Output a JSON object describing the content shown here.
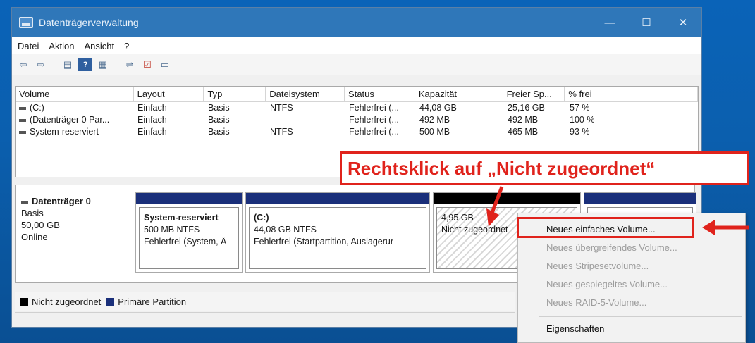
{
  "window": {
    "title": "Datenträgerverwaltung",
    "controls": [
      "—",
      "☐",
      "✕"
    ]
  },
  "menubar": [
    "Datei",
    "Aktion",
    "Ansicht",
    "?"
  ],
  "toolbar_icons": [
    "back-icon",
    "forward-icon",
    "disk-list-icon",
    "help-icon",
    "view-icon",
    "connect-icon",
    "check-icon",
    "properties-icon"
  ],
  "volume_table": {
    "columns": [
      "Volume",
      "Layout",
      "Typ",
      "Dateisystem",
      "Status",
      "Kapazität",
      "Freier Sp...",
      "% frei",
      ""
    ],
    "rows": [
      [
        "(C:)",
        "Einfach",
        "Basis",
        "NTFS",
        "Fehlerfrei (...",
        "44,08 GB",
        "25,16 GB",
        "57 %"
      ],
      [
        "(Datenträger 0 Par...",
        "Einfach",
        "Basis",
        "",
        "Fehlerfrei (...",
        "492 MB",
        "492 MB",
        "100 %"
      ],
      [
        "System-reserviert",
        "Einfach",
        "Basis",
        "NTFS",
        "Fehlerfrei (...",
        "500 MB",
        "465 MB",
        "93 %"
      ]
    ]
  },
  "disk": {
    "name": "Datenträger 0",
    "type": "Basis",
    "size": "50,00 GB",
    "state": "Online",
    "partitions": [
      {
        "name": "System-reserviert",
        "size": "500 MB NTFS",
        "status": "Fehlerfrei (System, Ä"
      },
      {
        "name": "(C:)",
        "size": "44,08 GB NTFS",
        "status": "Fehlerfrei (Startpartition, Auslagerur"
      },
      {
        "name": "",
        "size": "4,95 GB",
        "status": "Nicht zugeordnet"
      }
    ]
  },
  "legend": {
    "unallocated": "Nicht zugeordnet",
    "primary": "Primäre Partition",
    "colors": {
      "unallocated": "#000000",
      "primary": "#1a2f7a"
    }
  },
  "context_menu": {
    "items": [
      {
        "label": "Neues einfaches Volume...",
        "enabled": true
      },
      {
        "label": "Neues übergreifendes Volume...",
        "enabled": false
      },
      {
        "label": "Neues Stripesetvolume...",
        "enabled": false
      },
      {
        "label": "Neues gespiegeltes Volume...",
        "enabled": false
      },
      {
        "label": "Neues RAID-5-Volume...",
        "enabled": false
      }
    ],
    "properties": "Eigenschaften"
  },
  "annotation": {
    "callout": "Rechtsklick auf „Nicht zugeordnet“",
    "accent": "#e0231c"
  }
}
